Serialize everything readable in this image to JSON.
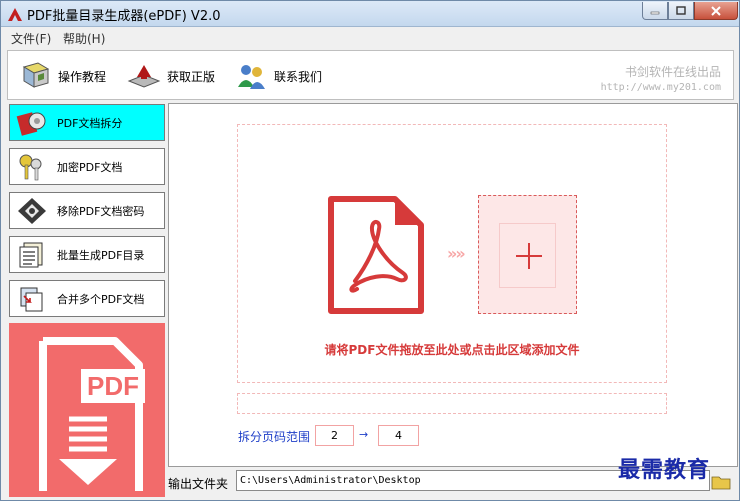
{
  "window": {
    "title": "PDF批量目录生成器(ePDF) V2.0"
  },
  "menu": {
    "file": "文件(F)",
    "help": "帮助(H)"
  },
  "toolbar": {
    "tutorial": "操作教程",
    "get_license": "获取正版",
    "contact": "联系我们",
    "brand_name": "书剑软件在线出品",
    "brand_url": "http://www.my201.com"
  },
  "sidebar": {
    "items": [
      {
        "label": "PDF文档拆分",
        "active": true
      },
      {
        "label": "加密PDF文档",
        "active": false
      },
      {
        "label": "移除PDF文档密码",
        "active": false
      },
      {
        "label": "批量生成PDF目录",
        "active": false
      },
      {
        "label": "合并多个PDF文档",
        "active": false
      }
    ],
    "logo_text": "PDF"
  },
  "main": {
    "drop_text": "请将PDF文件拖放至此处或点击此区域添加文件",
    "add_symbol": "+",
    "arrows": "»»",
    "range_label": "拆分页码范围",
    "range_from": "2",
    "range_arrow": "→",
    "range_to": "4"
  },
  "output": {
    "label": "输出文件夹",
    "path": "C:\\Users\\Administrator\\Desktop"
  },
  "watermark": "最需教育",
  "colors": {
    "accent_red": "#d63a3a",
    "active_tab": "#00ffff",
    "logo_bg": "#f26b6b",
    "link_blue": "#1f3fc8"
  }
}
